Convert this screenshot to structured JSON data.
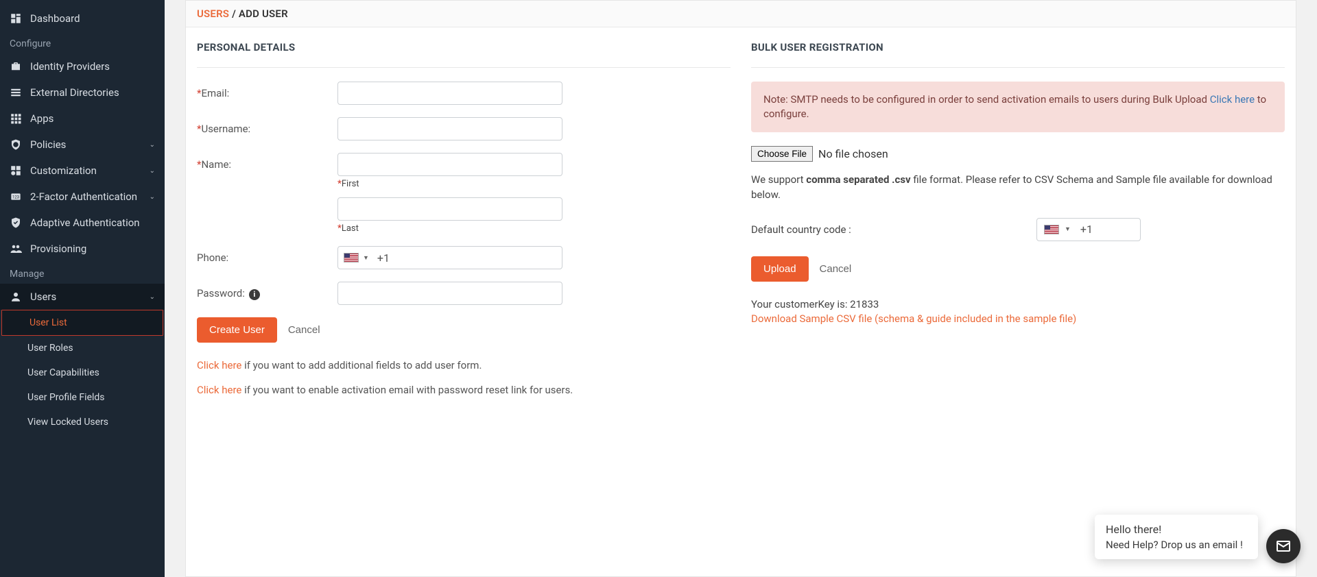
{
  "sidebar": {
    "items": {
      "dashboard": "Dashboard",
      "identity_providers": "Identity Providers",
      "external_directories": "External Directories",
      "apps": "Apps",
      "policies": "Policies",
      "customization": "Customization",
      "two_factor": "2-Factor Authentication",
      "adaptive_auth": "Adaptive Authentication",
      "provisioning": "Provisioning",
      "users": "Users"
    },
    "section_configure": "Configure",
    "section_manage": "Manage",
    "users_sub": {
      "user_list": "User List",
      "user_roles": "User Roles",
      "user_capabilities": "User Capabilities",
      "user_profile_fields": "User Profile Fields",
      "view_locked_users": "View Locked Users"
    }
  },
  "breadcrumb": {
    "root": "USERS",
    "sep": " / ",
    "current": "ADD USER"
  },
  "personal": {
    "heading": "PERSONAL DETAILS",
    "email_label": "Email:",
    "username_label": "Username:",
    "name_label": "Name:",
    "first_label": "First",
    "last_label": "Last",
    "phone_label": "Phone:",
    "password_label": "Password:",
    "phone_prefix": "+1",
    "create_btn": "Create User",
    "cancel_btn": "Cancel",
    "hint1_link": "Click here",
    "hint1_rest": " if you want to add additional fields to add user form.",
    "hint2_link": "Click here",
    "hint2_rest": " if you want to enable activation email with password reset link for users."
  },
  "bulk": {
    "heading": "BULK USER REGISTRATION",
    "alert_pre": "Note: SMTP needs to be configured in order to send activation emails to users during Bulk Upload ",
    "alert_link": "Click here",
    "alert_post": " to configure.",
    "choose_file": "Choose File",
    "no_file": "No file chosen",
    "support_pre": "We support ",
    "support_strong": "comma separated .csv",
    "support_post": " file format. Please refer to CSV Schema and Sample file available for download below.",
    "cc_label": "Default country code :",
    "cc_value": "+1",
    "upload_btn": "Upload",
    "cancel_btn": "Cancel",
    "customer_key_label": "Your customerKey is: ",
    "customer_key_value": "21833",
    "download_link": "Download Sample CSV file (schema & guide included in the sample file)"
  },
  "chat": {
    "line1": "Hello there!",
    "line2": "Need Help? Drop us an email !"
  }
}
